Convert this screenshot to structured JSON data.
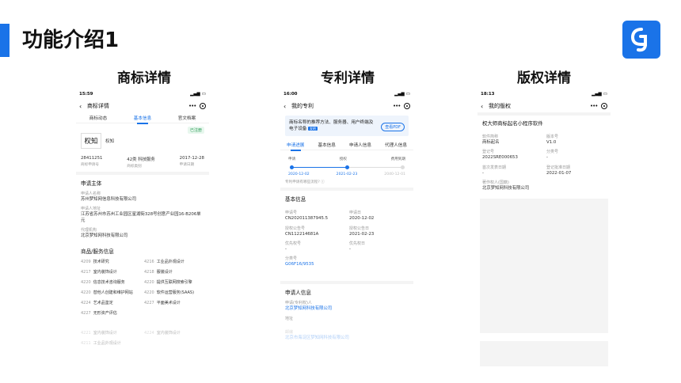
{
  "slide": {
    "title": "功能介绍1",
    "columns": [
      "商标详情",
      "专利详情",
      "版权详情"
    ]
  },
  "trademark": {
    "status_time": "15:59",
    "nav_title": "商标详情",
    "tabs": [
      "商标动态",
      "基本信息",
      "官文档案"
    ],
    "active_tab": 1,
    "badge": "已注册",
    "logo_text": "权知",
    "name": "权知",
    "stats": [
      {
        "value": "28411251",
        "label": "商标申请号"
      },
      {
        "value": "42类 科技服务",
        "label": "商标类别"
      },
      {
        "value": "2017-12-28",
        "label": "申请日期"
      }
    ],
    "applicant_title": "申请主体",
    "fields": [
      {
        "label": "申请人名称",
        "value": "苏州梦知网信息科技有限公司"
      },
      {
        "label": "申请人地址",
        "value": "江苏省苏州市苏州工业园区星湖街328号创意产业园16-B206单元"
      },
      {
        "label": "代理机构",
        "value": "北京梦知网科技有限公司"
      }
    ],
    "goods_title": "商品/服务信息",
    "goods": [
      {
        "code": "4209",
        "name": "技术研究"
      },
      {
        "code": "4216",
        "name": "工业品外观设计"
      },
      {
        "code": "4217",
        "name": "室内装饰设计"
      },
      {
        "code": "4218",
        "name": "服装设计"
      },
      {
        "code": "4220",
        "name": "信息技术咨询服务"
      },
      {
        "code": "4220",
        "name": "提供互联网搜索引擎"
      },
      {
        "code": "4220",
        "name": "替他人创建和维护网站"
      },
      {
        "code": "4220",
        "name": "软件运营服务(SAAS)"
      },
      {
        "code": "4224",
        "name": "艺术品鉴定"
      },
      {
        "code": "4227",
        "name": "平面美术设计"
      },
      {
        "code": "4227",
        "name": "无形资产评估"
      }
    ],
    "goods_faded": [
      {
        "code": "4221",
        "name": "室内装饰设计"
      },
      {
        "code": "4224",
        "name": "室内装饰设计"
      },
      {
        "code": "4211",
        "name": "工业品外观设计"
      }
    ]
  },
  "patent": {
    "status_time": "16:00",
    "nav_title": "我的专利",
    "banner_text": "商标名称的推荐方法、服务器、用户终端及电子设备",
    "banner_tag": "发明",
    "banner_button": "查看PDF",
    "tabs": [
      "申请进展",
      "基本信息",
      "申请人信息",
      "代理人信息"
    ],
    "active_tab": 0,
    "timeline": {
      "steps": [
        "申请",
        "授权",
        "费用到期"
      ],
      "dates": [
        "2020-12-02",
        "2021-02-23",
        "2040-12-01"
      ],
      "progress": 0.5,
      "question": "专利申请有哪些流程?"
    },
    "basic_title": "基本信息",
    "basic_fields": [
      {
        "label": "申请号",
        "value": "CN202011387945.5"
      },
      {
        "label": "申请日",
        "value": "2020-12-02"
      },
      {
        "label": "授权公告号",
        "value": "CN112214681A"
      },
      {
        "label": "授权公告日",
        "value": "2021-02-23"
      },
      {
        "label": "优先权号",
        "value": "-"
      },
      {
        "label": "优先权日",
        "value": "-"
      }
    ],
    "classification_label": "分类号",
    "classification_value": "G06F16/9535",
    "applicant_title": "申请人信息",
    "applicant_label": "申请(专利权)人",
    "applicant_value": "北京梦知网科技有限公司",
    "address_label": "地址",
    "faded_label": "邮编",
    "faded_value": "北京市海淀区梦知网科技有限公司"
  },
  "copyright": {
    "status_time": "18:13",
    "nav_title": "我的版权",
    "software_name": "权大师商标起名小程序软件",
    "fields": [
      {
        "label": "软件简称",
        "value": "商标起名"
      },
      {
        "label": "版本号",
        "value": "V1.0"
      },
      {
        "label": "登记号",
        "value": "2022SRE000653"
      },
      {
        "label": "分类号",
        "value": "-"
      },
      {
        "label": "首次发表日期",
        "value": "-"
      },
      {
        "label": "登记批准日期",
        "value": "2022-01-07"
      }
    ],
    "owner_label": "著作权人(国籍)",
    "owner_value": "北京梦知网科技有限公司"
  },
  "colors": {
    "accent": "#1a73e8",
    "badge_green": "#2a9d55"
  }
}
